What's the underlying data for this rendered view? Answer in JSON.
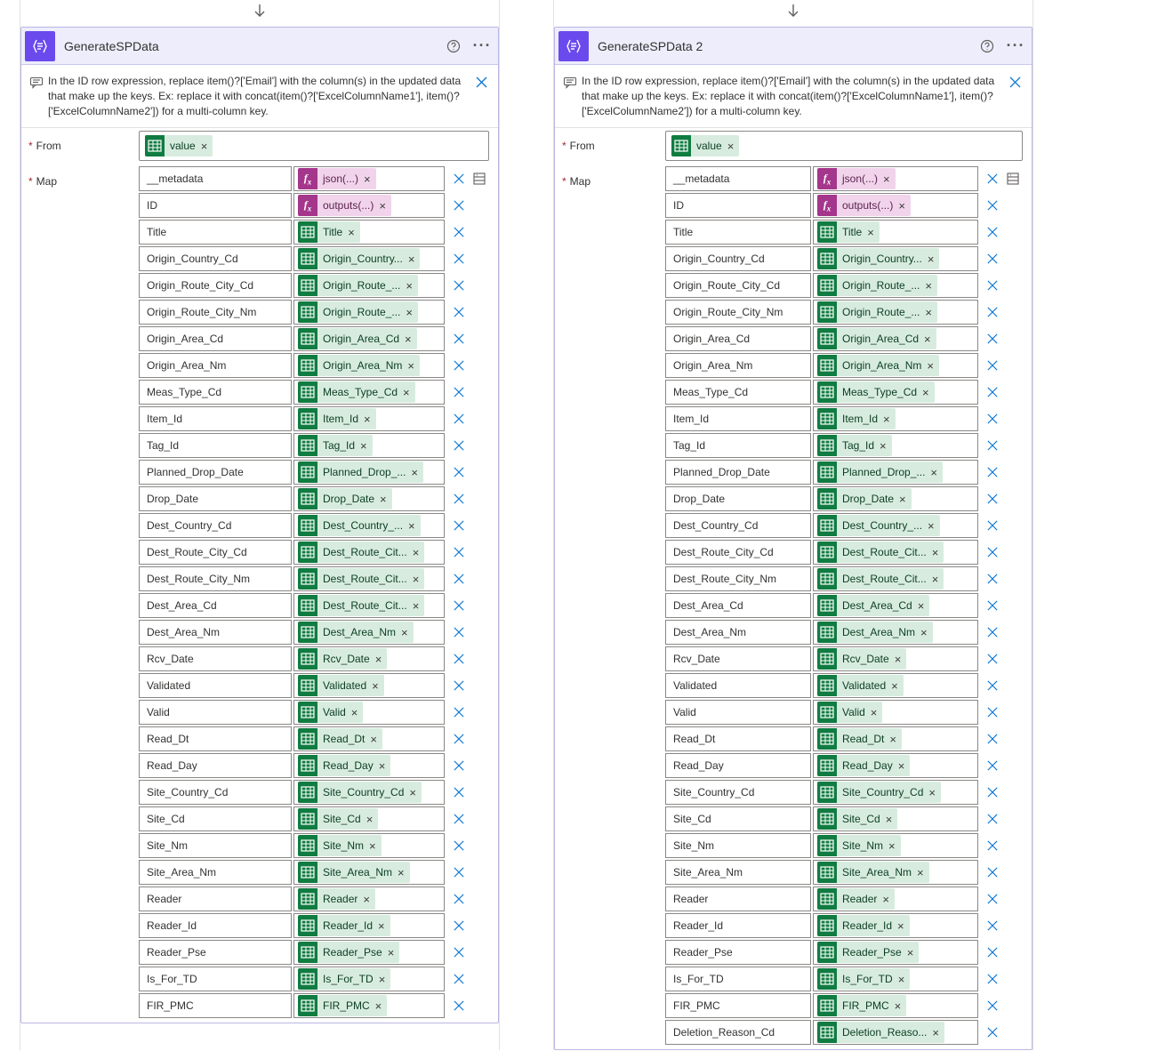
{
  "columns": [
    {
      "title": "GenerateSPData",
      "info_text": "In the ID row expression, replace item()?['Email'] with the column(s) in the updated data that make up the keys. Ex: replace it with concat(item()?['ExcelColumnName1'], item()?['ExcelColumnName2']) for a multi-column key.",
      "from_label": "From",
      "from_token": {
        "type": "excel",
        "text": "value"
      },
      "map_label": "Map",
      "rows": [
        {
          "key": "__metadata",
          "val": {
            "type": "fx",
            "text": "json(...)"
          }
        },
        {
          "key": "ID",
          "val": {
            "type": "fx",
            "text": "outputs(...)"
          }
        },
        {
          "key": "Title",
          "val": {
            "type": "excel",
            "text": "Title"
          }
        },
        {
          "key": "Origin_Country_Cd",
          "val": {
            "type": "excel",
            "text": "Origin_Country..."
          }
        },
        {
          "key": "Origin_Route_City_Cd",
          "val": {
            "type": "excel",
            "text": "Origin_Route_..."
          }
        },
        {
          "key": "Origin_Route_City_Nm",
          "val": {
            "type": "excel",
            "text": "Origin_Route_..."
          }
        },
        {
          "key": "Origin_Area_Cd",
          "val": {
            "type": "excel",
            "text": "Origin_Area_Cd"
          }
        },
        {
          "key": "Origin_Area_Nm",
          "val": {
            "type": "excel",
            "text": "Origin_Area_Nm"
          }
        },
        {
          "key": "Meas_Type_Cd",
          "val": {
            "type": "excel",
            "text": "Meas_Type_Cd"
          }
        },
        {
          "key": "Item_Id",
          "val": {
            "type": "excel",
            "text": "Item_Id"
          }
        },
        {
          "key": "Tag_Id",
          "val": {
            "type": "excel",
            "text": "Tag_Id"
          }
        },
        {
          "key": "Planned_Drop_Date",
          "val": {
            "type": "excel",
            "text": "Planned_Drop_..."
          }
        },
        {
          "key": "Drop_Date",
          "val": {
            "type": "excel",
            "text": "Drop_Date"
          }
        },
        {
          "key": "Dest_Country_Cd",
          "val": {
            "type": "excel",
            "text": "Dest_Country_..."
          }
        },
        {
          "key": "Dest_Route_City_Cd",
          "val": {
            "type": "excel",
            "text": "Dest_Route_Cit..."
          }
        },
        {
          "key": "Dest_Route_City_Nm",
          "val": {
            "type": "excel",
            "text": "Dest_Route_Cit..."
          }
        },
        {
          "key": "Dest_Area_Cd",
          "val": {
            "type": "excel",
            "text": "Dest_Route_Cit..."
          }
        },
        {
          "key": "Dest_Area_Nm",
          "val": {
            "type": "excel",
            "text": "Dest_Area_Nm"
          }
        },
        {
          "key": "Rcv_Date",
          "val": {
            "type": "excel",
            "text": "Rcv_Date"
          }
        },
        {
          "key": "Validated",
          "val": {
            "type": "excel",
            "text": "Validated"
          }
        },
        {
          "key": "Valid",
          "val": {
            "type": "excel",
            "text": "Valid"
          }
        },
        {
          "key": "Read_Dt",
          "val": {
            "type": "excel",
            "text": "Read_Dt"
          }
        },
        {
          "key": "Read_Day",
          "val": {
            "type": "excel",
            "text": "Read_Day"
          }
        },
        {
          "key": "Site_Country_Cd",
          "val": {
            "type": "excel",
            "text": "Site_Country_Cd"
          }
        },
        {
          "key": "Site_Cd",
          "val": {
            "type": "excel",
            "text": "Site_Cd"
          }
        },
        {
          "key": "Site_Nm",
          "val": {
            "type": "excel",
            "text": "Site_Nm"
          }
        },
        {
          "key": "Site_Area_Nm",
          "val": {
            "type": "excel",
            "text": "Site_Area_Nm"
          }
        },
        {
          "key": "Reader",
          "val": {
            "type": "excel",
            "text": "Reader"
          }
        },
        {
          "key": "Reader_Id",
          "val": {
            "type": "excel",
            "text": "Reader_Id"
          }
        },
        {
          "key": "Reader_Pse",
          "val": {
            "type": "excel",
            "text": "Reader_Pse"
          }
        },
        {
          "key": "Is_For_TD",
          "val": {
            "type": "excel",
            "text": "Is_For_TD"
          }
        },
        {
          "key": "FIR_PMC",
          "val": {
            "type": "excel",
            "text": "FIR_PMC"
          }
        }
      ]
    },
    {
      "title": "GenerateSPData 2",
      "info_text": "In the ID row expression, replace item()?['Email'] with the column(s) in the updated data that make up the keys. Ex: replace it with concat(item()?['ExcelColumnName1'], item()?['ExcelColumnName2']) for a multi-column key.",
      "from_label": "From",
      "from_token": {
        "type": "excel",
        "text": "value"
      },
      "map_label": "Map",
      "rows": [
        {
          "key": "__metadata",
          "val": {
            "type": "fx",
            "text": "json(...)"
          }
        },
        {
          "key": "ID",
          "val": {
            "type": "fx",
            "text": "outputs(...)"
          }
        },
        {
          "key": "Title",
          "val": {
            "type": "excel",
            "text": "Title"
          }
        },
        {
          "key": "Origin_Country_Cd",
          "val": {
            "type": "excel",
            "text": "Origin_Country..."
          }
        },
        {
          "key": "Origin_Route_City_Cd",
          "val": {
            "type": "excel",
            "text": "Origin_Route_..."
          }
        },
        {
          "key": "Origin_Route_City_Nm",
          "val": {
            "type": "excel",
            "text": "Origin_Route_..."
          }
        },
        {
          "key": "Origin_Area_Cd",
          "val": {
            "type": "excel",
            "text": "Origin_Area_Cd"
          }
        },
        {
          "key": "Origin_Area_Nm",
          "val": {
            "type": "excel",
            "text": "Origin_Area_Nm"
          }
        },
        {
          "key": "Meas_Type_Cd",
          "val": {
            "type": "excel",
            "text": "Meas_Type_Cd"
          }
        },
        {
          "key": "Item_Id",
          "val": {
            "type": "excel",
            "text": "Item_Id"
          }
        },
        {
          "key": "Tag_Id",
          "val": {
            "type": "excel",
            "text": "Tag_Id"
          }
        },
        {
          "key": "Planned_Drop_Date",
          "val": {
            "type": "excel",
            "text": "Planned_Drop_..."
          }
        },
        {
          "key": "Drop_Date",
          "val": {
            "type": "excel",
            "text": "Drop_Date"
          }
        },
        {
          "key": "Dest_Country_Cd",
          "val": {
            "type": "excel",
            "text": "Dest_Country_..."
          }
        },
        {
          "key": "Dest_Route_City_Cd",
          "val": {
            "type": "excel",
            "text": "Dest_Route_Cit..."
          }
        },
        {
          "key": "Dest_Route_City_Nm",
          "val": {
            "type": "excel",
            "text": "Dest_Route_Cit..."
          }
        },
        {
          "key": "Dest_Area_Cd",
          "val": {
            "type": "excel",
            "text": "Dest_Area_Cd"
          }
        },
        {
          "key": "Dest_Area_Nm",
          "val": {
            "type": "excel",
            "text": "Dest_Area_Nm"
          }
        },
        {
          "key": "Rcv_Date",
          "val": {
            "type": "excel",
            "text": "Rcv_Date"
          }
        },
        {
          "key": "Validated",
          "val": {
            "type": "excel",
            "text": "Validated"
          }
        },
        {
          "key": "Valid",
          "val": {
            "type": "excel",
            "text": "Valid"
          }
        },
        {
          "key": "Read_Dt",
          "val": {
            "type": "excel",
            "text": "Read_Dt"
          }
        },
        {
          "key": "Read_Day",
          "val": {
            "type": "excel",
            "text": "Read_Day"
          }
        },
        {
          "key": "Site_Country_Cd",
          "val": {
            "type": "excel",
            "text": "Site_Country_Cd"
          }
        },
        {
          "key": "Site_Cd",
          "val": {
            "type": "excel",
            "text": "Site_Cd"
          }
        },
        {
          "key": "Site_Nm",
          "val": {
            "type": "excel",
            "text": "Site_Nm"
          }
        },
        {
          "key": "Site_Area_Nm",
          "val": {
            "type": "excel",
            "text": "Site_Area_Nm"
          }
        },
        {
          "key": "Reader",
          "val": {
            "type": "excel",
            "text": "Reader"
          }
        },
        {
          "key": "Reader_Id",
          "val": {
            "type": "excel",
            "text": "Reader_Id"
          }
        },
        {
          "key": "Reader_Pse",
          "val": {
            "type": "excel",
            "text": "Reader_Pse"
          }
        },
        {
          "key": "Is_For_TD",
          "val": {
            "type": "excel",
            "text": "Is_For_TD"
          }
        },
        {
          "key": "FIR_PMC",
          "val": {
            "type": "excel",
            "text": "FIR_PMC"
          }
        },
        {
          "key": "Deletion_Reason_Cd",
          "val": {
            "type": "excel",
            "text": "Deletion_Reaso..."
          }
        }
      ]
    }
  ]
}
